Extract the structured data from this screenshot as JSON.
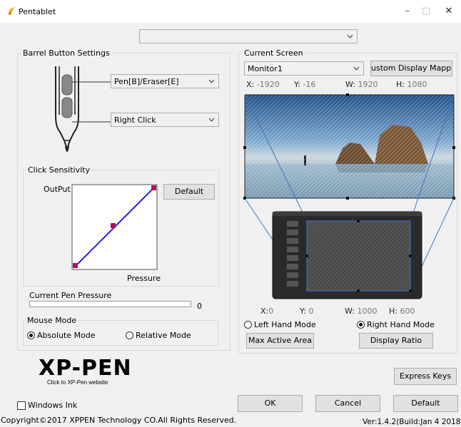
{
  "window": {
    "title": "Pentablet",
    "minimize": "–",
    "maximize": "□",
    "close": "✕"
  },
  "top_combo": {
    "value": ""
  },
  "barrel": {
    "group_label": "Barrel Button Settings",
    "upper_button": "Pen[B]/Eraser[E]",
    "lower_button": "Right Click"
  },
  "sensitivity": {
    "group_label": "Click Sensitivity",
    "output_label": "OutPut",
    "pressure_label": "Pressure",
    "default_button": "Default",
    "curve_color": "#2222cc",
    "handle_color": "#b0105a"
  },
  "pen_pressure": {
    "label": "Current Pen Pressure",
    "value": "0",
    "level": 0
  },
  "mouse_mode": {
    "group_label": "Mouse Mode",
    "absolute": "Absolute Mode",
    "relative": "Relative Mode",
    "selected": "absolute"
  },
  "screen": {
    "group_label": "Current Screen",
    "monitor": "Monitor1",
    "custom_button": "ustom Display Mappin",
    "x_label": "X:",
    "x": "-1920",
    "y_label": "Y:",
    "y": "-16",
    "w_label": "W:",
    "w": "1920",
    "h_label": "H:",
    "h": "1080"
  },
  "tablet_area": {
    "x_label": "X:",
    "x": "0",
    "y_label": "Y:",
    "y": "0",
    "w_label": "W:",
    "w": "1000",
    "h_label": "H:",
    "h": "600",
    "left_hand": "Left Hand Mode",
    "right_hand": "Right Hand Mode",
    "selected_hand": "right",
    "max_active_button": "Max Active Area",
    "display_ratio_button": "Display Ratio"
  },
  "logo": {
    "text": "XP-PEN",
    "caption": "Click to XP-Pen website"
  },
  "express_keys_button": "Express Keys",
  "windows_ink": {
    "label": "Windows Ink",
    "checked": false
  },
  "footer": {
    "ok": "OK",
    "cancel": "Cancel",
    "default": "Default",
    "copyright": "Copyright©2017 XPPEN Technology CO.All Rights Reserved.",
    "version": "Ver:1.4.2(Build:Jan  4 2018"
  }
}
